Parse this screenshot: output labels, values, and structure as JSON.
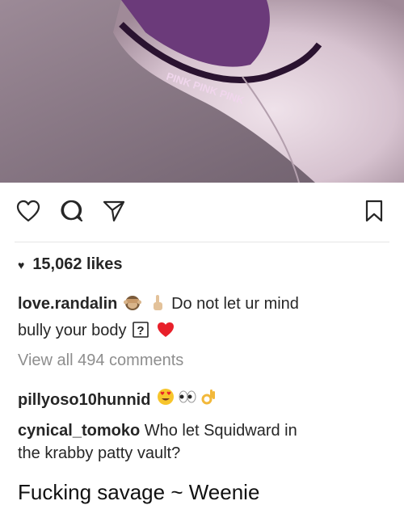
{
  "post": {
    "likes_count": "15,062 likes",
    "caption": {
      "username": "love.randalin",
      "text_line1": "Do not let ur mind",
      "text_line2": "bully your body",
      "emoji_names": [
        "see-no-evil-monkey-emoji",
        "index-pointing-up-emoji",
        "question-box-emoji",
        "red-heart-emoji"
      ]
    },
    "view_all_comments": "View all 494 comments",
    "comments": [
      {
        "username": "pillyoso10hunnid",
        "text": "",
        "emoji_names": [
          "heart-eyes-emoji",
          "eyes-emoji",
          "ok-hand-emoji"
        ]
      },
      {
        "username": "cynical_tomoko",
        "text_line1": "Who let Squidward in",
        "text_line2": "the krabby patty vault?"
      }
    ],
    "question_box_glyph": "?",
    "photo_waistband_text": "PINK PINK PINK"
  },
  "footer": {
    "text": "Fucking savage ~ Weenie"
  },
  "icons": [
    "heart-icon",
    "comment-icon",
    "share-icon",
    "bookmark-icon"
  ],
  "colors": {
    "text": "#262626",
    "muted": "#8e8e8e",
    "photo_fabric": "#7a4a8a",
    "photo_skin": "#d8c4ce"
  }
}
